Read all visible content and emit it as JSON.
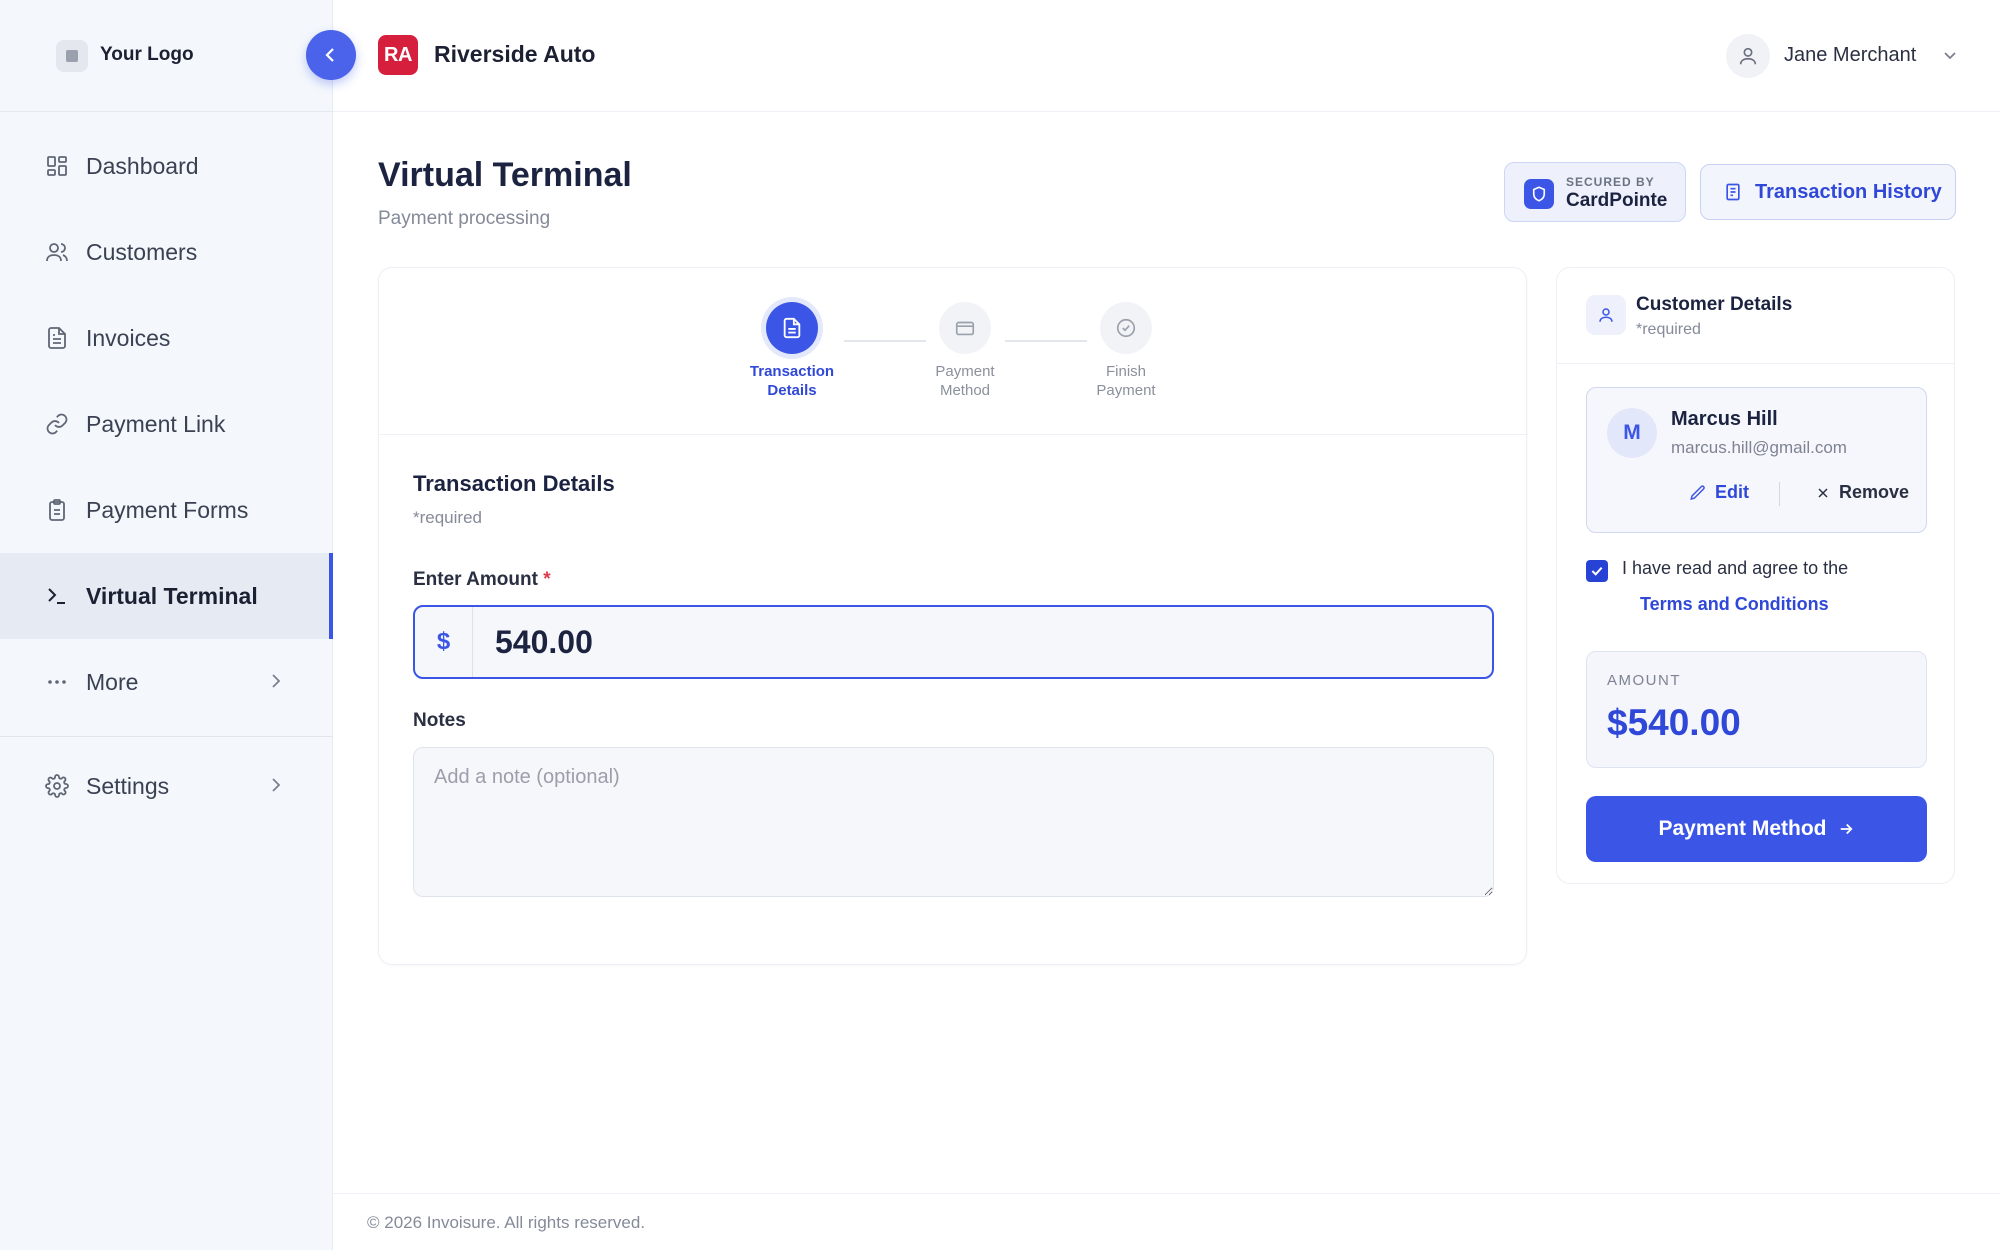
{
  "sidebar": {
    "logo_text": "Your Logo",
    "items": [
      {
        "label": "Dashboard",
        "icon": "grid-icon"
      },
      {
        "label": "Customers",
        "icon": "users-icon"
      },
      {
        "label": "Invoices",
        "icon": "file-icon"
      },
      {
        "label": "Payment Link",
        "icon": "link-icon"
      },
      {
        "label": "Payment Forms",
        "icon": "clipboard-icon"
      },
      {
        "label": "Virtual Terminal",
        "icon": "terminal-icon",
        "active": true
      },
      {
        "label": "More",
        "icon": "more-icon"
      }
    ],
    "settings_label": "Settings"
  },
  "header": {
    "business_initials": "RA",
    "business_name": "Riverside Auto",
    "user_name": "Jane Merchant"
  },
  "page": {
    "title": "Virtual Terminal",
    "subtitle": "Payment processing",
    "secured_label": "SECURED BY",
    "secured_brand": "CardPointe",
    "history_label": "Transaction History"
  },
  "stepper": {
    "steps": [
      {
        "line1": "Transaction",
        "line2": "Details",
        "state": "active"
      },
      {
        "line1": "Payment",
        "line2": "Method",
        "state": "todo"
      },
      {
        "line1": "Finish",
        "line2": "Payment",
        "state": "todo"
      }
    ]
  },
  "form": {
    "section_title": "Transaction Details",
    "required_note": "*required",
    "amount_label": "Enter Amount",
    "required_star": "*",
    "currency_symbol": "$",
    "amount_value": "540.00",
    "notes_label": "Notes",
    "notes_placeholder": "Add a note (optional)"
  },
  "customer_panel": {
    "title": "Customer Details",
    "required_note": "*required",
    "customer": {
      "initial": "M",
      "name": "Marcus Hill",
      "email": "marcus.hill@gmail.com"
    },
    "edit_label": "Edit",
    "remove_label": "Remove",
    "agree_text": "I have read and agree to the",
    "terms_link": "Terms and Conditions",
    "agree_checked": true,
    "amount_label": "AMOUNT",
    "amount_value": "$540.00",
    "next_button": "Payment Method"
  },
  "footer": {
    "copyright": "© 2026 Invoisure. All rights reserved."
  },
  "colors": {
    "accent": "#3b55e6",
    "brand_badge": "#d61f3c",
    "required": "#e03a4a"
  }
}
